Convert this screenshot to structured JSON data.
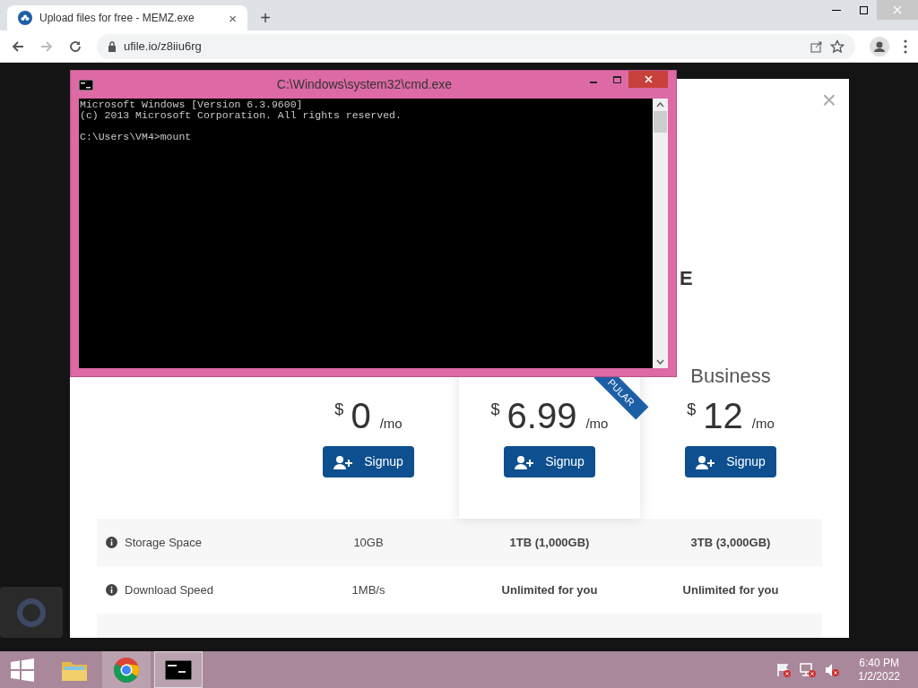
{
  "browser": {
    "tab": {
      "title": "Upload files for free - MEMZ.exe",
      "close": "×"
    },
    "new_tab": "+",
    "address": "ufile.io/z8iiu6rg"
  },
  "cmd": {
    "title": "C:\\Windows\\system32\\cmd.exe",
    "blocks": [
      [
        "Microsoft Windows [Version 6.3.9600]",
        "(c) 2013 Microsoft Corporation. All rights reserved."
      ],
      [
        "C:\\Users\\VM4>mount"
      ]
    ]
  },
  "modal": {
    "close": "×",
    "logo_fragment": "E",
    "plans": [
      {
        "currency": "$",
        "price": "0",
        "period": "/mo",
        "button": "Signup"
      },
      {
        "currency": "$",
        "price": "6.99",
        "period": "/mo",
        "button": "Signup",
        "ribbon": "PULAR"
      },
      {
        "name": "Business",
        "currency": "$",
        "price": "12",
        "period": "/mo",
        "button": "Signup"
      }
    ],
    "features": [
      {
        "label": "Storage Space",
        "values": [
          {
            "text": "10GB",
            "bold": false
          },
          {
            "text": "1TB (1,000GB)",
            "bold": true
          },
          {
            "text": "3TB (3,000GB)",
            "bold": true
          }
        ]
      },
      {
        "label": "Download Speed",
        "values": [
          {
            "text": "1MB/s",
            "bold": false
          },
          {
            "text": "Unlimited for you",
            "bold": true
          },
          {
            "text": "Unlimited for you",
            "bold": true
          }
        ]
      }
    ]
  },
  "taskbar": {
    "apps": [
      {
        "kind": "folder",
        "running": false,
        "selected": false
      },
      {
        "kind": "chrome",
        "running": true,
        "selected": false
      },
      {
        "kind": "cmd",
        "running": true,
        "selected": true
      }
    ],
    "time": "6:40 PM",
    "date": "1/2/2022"
  }
}
